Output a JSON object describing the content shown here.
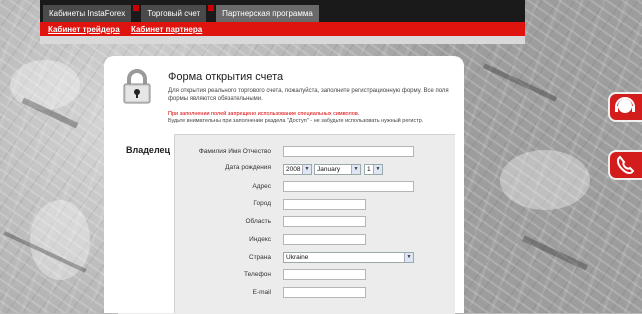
{
  "header": {
    "tabs": [
      {
        "label": "Кабинеты InstaForex"
      },
      {
        "label": "Торговый счет"
      },
      {
        "label": "Партнерская программа"
      }
    ],
    "sublinks": [
      {
        "label": "Кабинет трейдера"
      },
      {
        "label": "Кабинет партнера"
      }
    ]
  },
  "form": {
    "title": "Форма открытия счета",
    "description": "Для открытия реального торгового счета, пожалуйста, заполните регистрационную форму. Все поля формы являются обязательными.",
    "warning": "При заполнении полей запрещено использование специальных символов.",
    "notice": "Будьте внимательны при заполнении раздела \"Доступ\" - не забудьте использовать нужный регистр."
  },
  "section": {
    "title": "Владелец",
    "fields": {
      "full_name": {
        "label": "Фамилия Имя Отчество",
        "value": ""
      },
      "birth_date": {
        "label": "Дата рождения",
        "year": "2008",
        "month": "January",
        "day": "1"
      },
      "address": {
        "label": "Адрес",
        "value": ""
      },
      "city": {
        "label": "Город",
        "value": ""
      },
      "region": {
        "label": "Область",
        "value": ""
      },
      "zip": {
        "label": "Индекс",
        "value": ""
      },
      "country": {
        "label": "Страна",
        "value": "Ukraine"
      },
      "phone": {
        "label": "Телефон",
        "value": ""
      },
      "email": {
        "label": "E-mail",
        "value": ""
      }
    }
  },
  "side": {
    "icons": [
      "headset-icon",
      "phone-icon"
    ]
  },
  "colors": {
    "accent": "#e0140f",
    "header_bg": "#1a1a1a",
    "panel_bg": "#ffffff",
    "section_bg": "#ececec"
  }
}
